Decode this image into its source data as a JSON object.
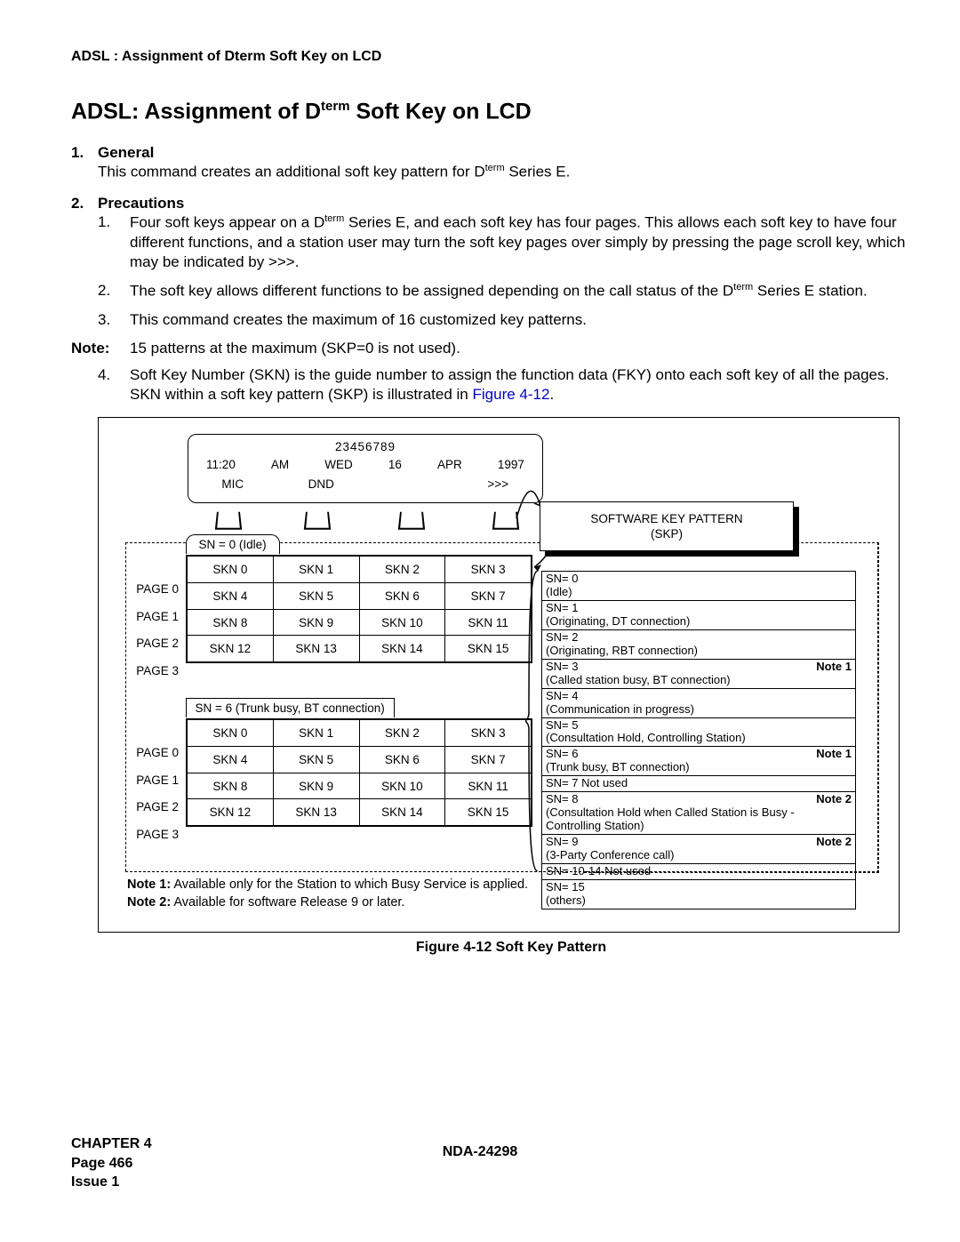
{
  "running_head": "ADSL : Assignment of Dterm Soft Key on LCD",
  "title_prefix": "ADSL: Assignment of D",
  "title_super": "term",
  "title_suffix": " Soft Key on LCD",
  "sections": {
    "s1": {
      "num": "1.",
      "head": "General",
      "body": "This command creates an additional soft key pattern for D",
      "body_sup": "term",
      "body_tail": " Series E."
    },
    "s2": {
      "num": "2.",
      "head": "Precautions"
    }
  },
  "prec": {
    "p1": {
      "num": "1.",
      "a": "Four soft keys appear on a D",
      "sup": "term",
      "b": " Series E, and each soft key has four pages. This allows each soft key to have four different functions, and a station user may turn the soft key pages over simply by pressing the page scroll key, which may be indicated by >>>."
    },
    "p2": {
      "num": "2.",
      "a": "The soft key allows different functions to be assigned depending on the call status of the D",
      "sup": "term",
      "b": " Series E station."
    },
    "p3": {
      "num": "3.",
      "txt": "This command creates the maximum of 16 customized key patterns."
    },
    "note": {
      "lbl": "Note:",
      "txt": "15 patterns at the maximum (SKP=0 is not used)."
    },
    "p4": {
      "num": "4.",
      "a": "Soft Key Number (SKN) is the guide number to assign the function data (FKY) onto each soft key of all the pages. SKN within a soft key pattern (SKP) is illustrated in ",
      "link": "Figure 4-12",
      "b": "."
    }
  },
  "lcd": {
    "row1": "23456789",
    "row2": [
      "11:20",
      "AM",
      "WED",
      "16",
      "APR",
      "1997"
    ],
    "row3": {
      "c1": "MIC",
      "c2": "DND",
      "c4": ">>>"
    }
  },
  "skp_box": {
    "l1": "SOFTWARE KEY PATTERN",
    "l2": "(SKP)"
  },
  "pages": [
    "PAGE 0",
    "PAGE 1",
    "PAGE 2",
    "PAGE 3"
  ],
  "sn_headers": {
    "h1": "SN = 0 (Idle)",
    "h2": "SN = 6 (Trunk busy, BT connection)"
  },
  "sn_grid": [
    [
      "SKN 0",
      "SKN 1",
      "SKN 2",
      "SKN 3"
    ],
    [
      "SKN 4",
      "SKN 5",
      "SKN 6",
      "SKN 7"
    ],
    [
      "SKN 8",
      "SKN 9",
      "SKN 10",
      "SKN 11"
    ],
    [
      "SKN 12",
      "SKN 13",
      "SKN 14",
      "SKN 15"
    ]
  ],
  "sn_list": [
    {
      "t": "SN= 0\n(Idle)"
    },
    {
      "t": "SN= 1\n(Originating, DT connection)"
    },
    {
      "t": "SN= 2\n(Originating, RBT connection)"
    },
    {
      "t": "SN= 3\n(Called station busy, BT connection)",
      "n": "Note 1"
    },
    {
      "t": "SN= 4\n(Communication in progress)"
    },
    {
      "t": "SN= 5\n(Consultation Hold, Controlling Station)"
    },
    {
      "t": "SN= 6\n(Trunk busy, BT connection)",
      "n": "Note 1"
    },
    {
      "t": "SN= 7  Not used"
    },
    {
      "t": "SN= 8\n(Consultation Hold when Called Station is Busy - Controlling Station)",
      "n": "Note 2"
    },
    {
      "t": "SN= 9\n(3-Party Conference call)",
      "n": "Note 2"
    },
    {
      "t": "SN= 10-14 Not used"
    },
    {
      "t": "SN= 15\n(others)"
    }
  ],
  "fig_notes": {
    "n1": {
      "b": "Note 1:",
      "t": "  Available only for the Station to which Busy Service is applied."
    },
    "n2": {
      "b": "Note 2:",
      "t": "  Available for software Release 9 or later."
    }
  },
  "fig_caption": "Figure 4-12   Soft Key Pattern",
  "footer": {
    "l1": "CHAPTER 4",
    "l2": "Page 466",
    "l3": "Issue 1",
    "mid": "NDA-24298"
  }
}
